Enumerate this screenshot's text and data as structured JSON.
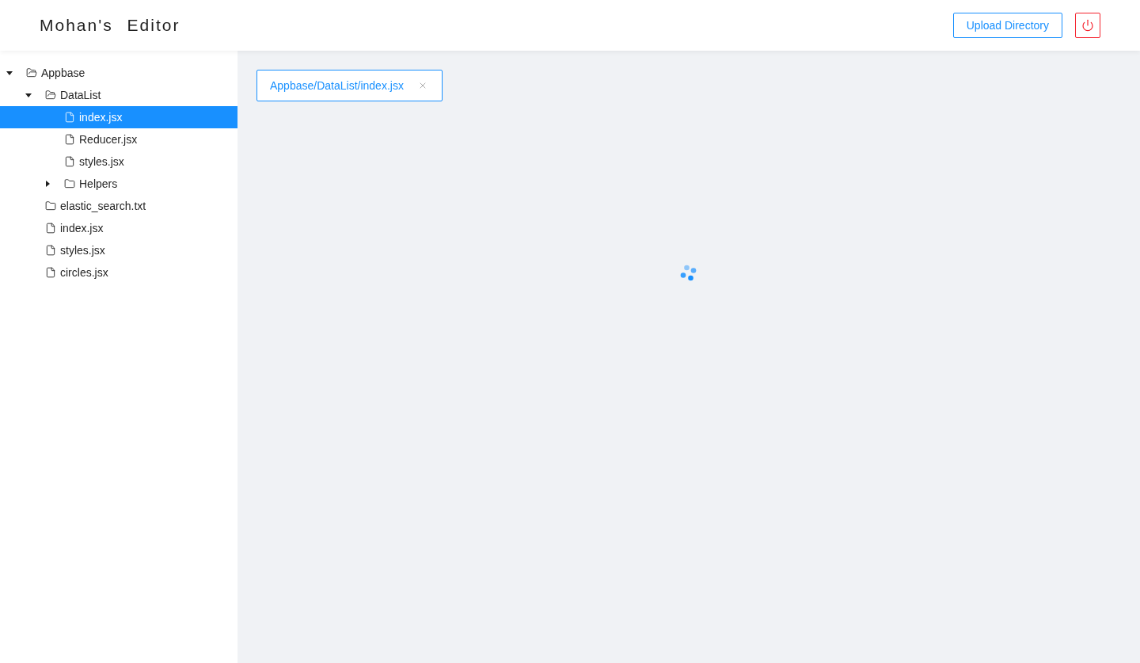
{
  "header": {
    "title": "Mohan's Editor",
    "upload_button": "Upload Directory"
  },
  "tree": [
    {
      "kind": "folder",
      "label": "Appbase",
      "expanded": true,
      "selected": false,
      "children": [
        {
          "kind": "folder",
          "label": "DataList",
          "expanded": true,
          "selected": false,
          "children": [
            {
              "kind": "file",
              "label": "index.jsx",
              "selected": true
            },
            {
              "kind": "file",
              "label": "Reducer.jsx",
              "selected": false
            },
            {
              "kind": "file",
              "label": "styles.jsx",
              "selected": false
            },
            {
              "kind": "folder",
              "label": "Helpers",
              "expanded": false,
              "selected": false
            }
          ]
        },
        {
          "kind": "folder",
          "label": "elastic_search.txt",
          "selected": false
        },
        {
          "kind": "file",
          "label": "index.jsx",
          "selected": false
        },
        {
          "kind": "file",
          "label": "styles.jsx",
          "selected": false
        },
        {
          "kind": "file",
          "label": "circles.jsx",
          "selected": false
        }
      ]
    }
  ],
  "tabs": [
    {
      "label": "Appbase/DataList/index.jsx",
      "selected": true
    }
  ],
  "editor": {
    "loading": true
  }
}
